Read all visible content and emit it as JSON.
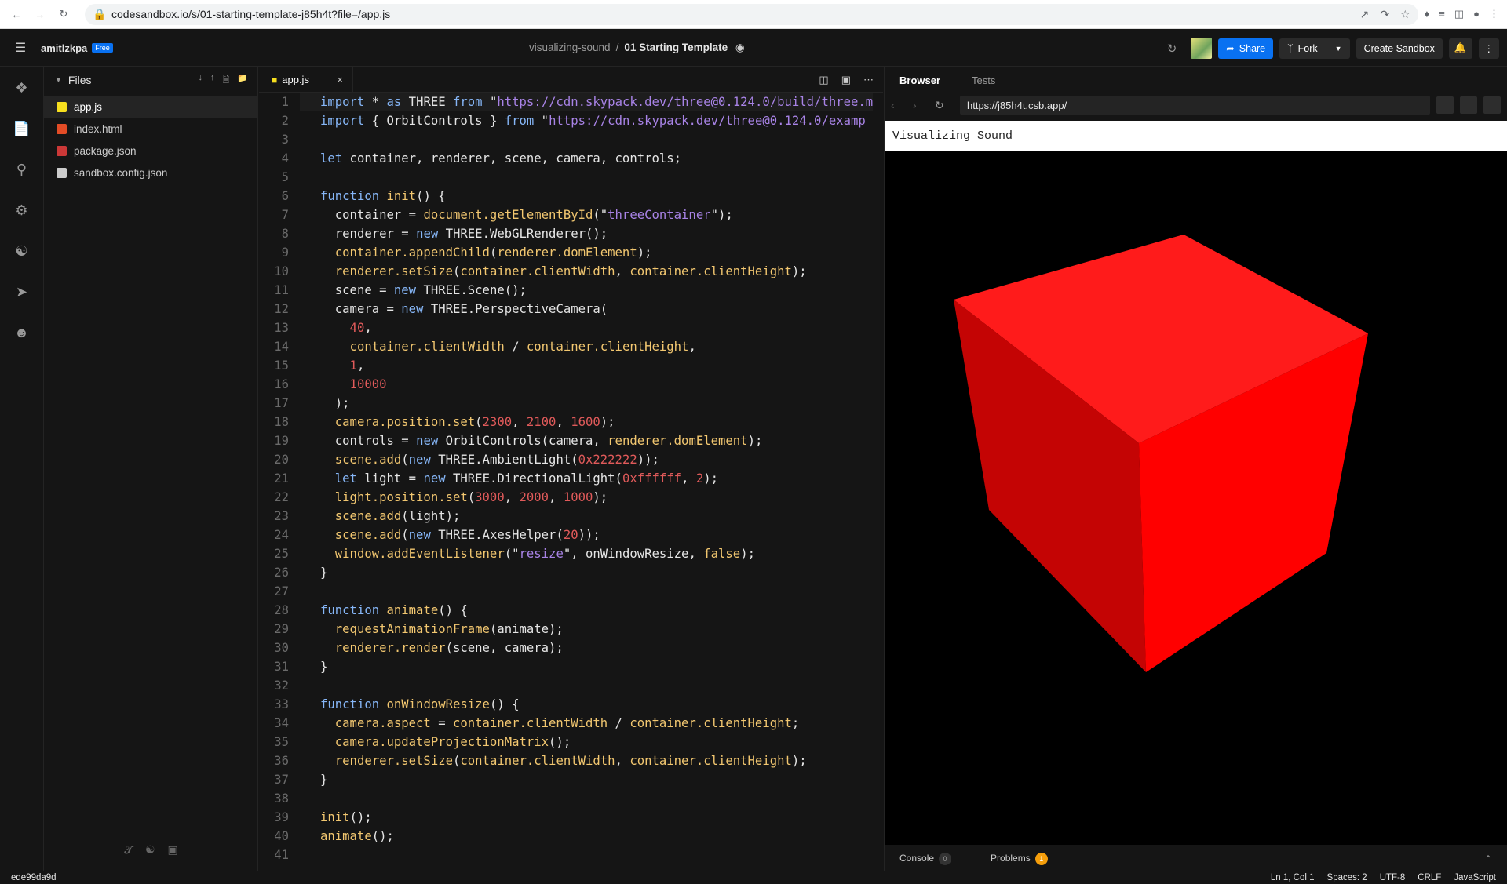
{
  "browser": {
    "url": "codesandbox.io/s/01-starting-template-j85h4t?file=/app.js"
  },
  "topbar": {
    "user": "amitlzkpa",
    "plan": "Free",
    "crumb_parent": "visualizing-sound",
    "crumb_sep": "/",
    "title": "01 Starting Template",
    "share": "Share",
    "fork": "Fork",
    "create": "Create Sandbox"
  },
  "files": {
    "header": "Files",
    "items": [
      {
        "name": "app.js",
        "icon": "js-icon",
        "color": "#f7df1e",
        "selected": true
      },
      {
        "name": "index.html",
        "icon": "html-icon",
        "color": "#e34c26"
      },
      {
        "name": "package.json",
        "icon": "npm-icon",
        "color": "#cb3837"
      },
      {
        "name": "sandbox.config.json",
        "icon": "cube-icon",
        "color": "#cccccc"
      }
    ]
  },
  "editor": {
    "tab": "app.js",
    "close": "×"
  },
  "code": [
    [
      [
        "k",
        "import"
      ],
      [
        "p",
        " * "
      ],
      [
        "k",
        "as"
      ],
      [
        "p",
        " THREE "
      ],
      [
        "k",
        "from"
      ],
      [
        "p",
        " \""
      ],
      [
        "u",
        "https://cdn.skypack.dev/three@0.124.0/build/three.m"
      ]
    ],
    [
      [
        "k",
        "import"
      ],
      [
        "p",
        " { OrbitControls } "
      ],
      [
        "k",
        "from"
      ],
      [
        "p",
        " \""
      ],
      [
        "u",
        "https://cdn.skypack.dev/three@0.124.0/examp"
      ]
    ],
    [],
    [
      [
        "k",
        "let"
      ],
      [
        "p",
        " container, renderer, scene, camera, controls;"
      ]
    ],
    [],
    [
      [
        "k",
        "function"
      ],
      [
        "p",
        " "
      ],
      [
        "f",
        "init"
      ],
      [
        "p",
        "() {"
      ]
    ],
    [
      [
        "p",
        "  container = "
      ],
      [
        "f",
        "document.getElementById"
      ],
      [
        "p",
        "(\""
      ],
      [
        "s",
        "threeContainer"
      ],
      [
        "p",
        "\");"
      ]
    ],
    [
      [
        "p",
        "  renderer = "
      ],
      [
        "k",
        "new"
      ],
      [
        "p",
        " THREE.WebGLRenderer();"
      ]
    ],
    [
      [
        "f",
        "  container.appendChild"
      ],
      [
        "p",
        "("
      ],
      [
        "f",
        "renderer.domElement"
      ],
      [
        "p",
        ");"
      ]
    ],
    [
      [
        "f",
        "  renderer.setSize"
      ],
      [
        "p",
        "("
      ],
      [
        "f",
        "container.clientWidth"
      ],
      [
        "p",
        ", "
      ],
      [
        "f",
        "container.clientHeight"
      ],
      [
        "p",
        ");"
      ]
    ],
    [
      [
        "p",
        "  scene = "
      ],
      [
        "k",
        "new"
      ],
      [
        "p",
        " THREE.Scene();"
      ]
    ],
    [
      [
        "p",
        "  camera = "
      ],
      [
        "k",
        "new"
      ],
      [
        "p",
        " THREE.PerspectiveCamera("
      ]
    ],
    [
      [
        "num",
        "    40"
      ],
      [
        "p",
        ","
      ]
    ],
    [
      [
        "f",
        "    container.clientWidth"
      ],
      [
        "p",
        " / "
      ],
      [
        "f",
        "container.clientHeight"
      ],
      [
        "p",
        ","
      ]
    ],
    [
      [
        "num",
        "    1"
      ],
      [
        "p",
        ","
      ]
    ],
    [
      [
        "num",
        "    10000"
      ]
    ],
    [
      [
        "p",
        "  );"
      ]
    ],
    [
      [
        "f",
        "  camera.position.set"
      ],
      [
        "p",
        "("
      ],
      [
        "num",
        "2300"
      ],
      [
        "p",
        ", "
      ],
      [
        "num",
        "2100"
      ],
      [
        "p",
        ", "
      ],
      [
        "num",
        "1600"
      ],
      [
        "p",
        ");"
      ]
    ],
    [
      [
        "p",
        "  controls = "
      ],
      [
        "k",
        "new"
      ],
      [
        "p",
        " OrbitControls(camera, "
      ],
      [
        "f",
        "renderer.domElement"
      ],
      [
        "p",
        ");"
      ]
    ],
    [
      [
        "f",
        "  scene.add"
      ],
      [
        "p",
        "("
      ],
      [
        "k",
        "new"
      ],
      [
        "p",
        " THREE.AmbientLight("
      ],
      [
        "num",
        "0x222222"
      ],
      [
        "p",
        "));"
      ]
    ],
    [
      [
        "k",
        "  let"
      ],
      [
        "p",
        " light = "
      ],
      [
        "k",
        "new"
      ],
      [
        "p",
        " THREE.DirectionalLight("
      ],
      [
        "num",
        "0xffffff"
      ],
      [
        "p",
        ", "
      ],
      [
        "num",
        "2"
      ],
      [
        "p",
        ");"
      ]
    ],
    [
      [
        "f",
        "  light.position.set"
      ],
      [
        "p",
        "("
      ],
      [
        "num",
        "3000"
      ],
      [
        "p",
        ", "
      ],
      [
        "num",
        "2000"
      ],
      [
        "p",
        ", "
      ],
      [
        "num",
        "1000"
      ],
      [
        "p",
        ");"
      ]
    ],
    [
      [
        "f",
        "  scene.add"
      ],
      [
        "p",
        "(light);"
      ]
    ],
    [
      [
        "f",
        "  scene.add"
      ],
      [
        "p",
        "("
      ],
      [
        "k",
        "new"
      ],
      [
        "p",
        " THREE.AxesHelper("
      ],
      [
        "num",
        "20"
      ],
      [
        "p",
        "));"
      ]
    ],
    [
      [
        "f",
        "  window.addEventListener"
      ],
      [
        "p",
        "(\""
      ],
      [
        "s",
        "resize"
      ],
      [
        "p",
        "\", onWindowResize, "
      ],
      [
        "f",
        "false"
      ],
      [
        "p",
        ");"
      ]
    ],
    [
      [
        "p",
        "}"
      ]
    ],
    [],
    [
      [
        "k",
        "function"
      ],
      [
        "p",
        " "
      ],
      [
        "f",
        "animate"
      ],
      [
        "p",
        "() {"
      ]
    ],
    [
      [
        "f",
        "  requestAnimationFrame"
      ],
      [
        "p",
        "(animate);"
      ]
    ],
    [
      [
        "f",
        "  renderer.render"
      ],
      [
        "p",
        "(scene, camera);"
      ]
    ],
    [
      [
        "p",
        "}"
      ]
    ],
    [],
    [
      [
        "k",
        "function"
      ],
      [
        "p",
        " "
      ],
      [
        "f",
        "onWindowResize"
      ],
      [
        "p",
        "() {"
      ]
    ],
    [
      [
        "f",
        "  camera.aspect"
      ],
      [
        "p",
        " = "
      ],
      [
        "f",
        "container.clientWidth"
      ],
      [
        "p",
        " / "
      ],
      [
        "f",
        "container.clientHeight"
      ],
      [
        "p",
        ";"
      ]
    ],
    [
      [
        "f",
        "  camera.updateProjectionMatrix"
      ],
      [
        "p",
        "();"
      ]
    ],
    [
      [
        "f",
        "  renderer.setSize"
      ],
      [
        "p",
        "("
      ],
      [
        "f",
        "container.clientWidth"
      ],
      [
        "p",
        ", "
      ],
      [
        "f",
        "container.clientHeight"
      ],
      [
        "p",
        ");"
      ]
    ],
    [
      [
        "p",
        "}"
      ]
    ],
    [],
    [
      [
        "f",
        "init"
      ],
      [
        "p",
        "();"
      ]
    ],
    [
      [
        "f",
        "animate"
      ],
      [
        "p",
        "();"
      ]
    ],
    []
  ],
  "preview": {
    "tab_browser": "Browser",
    "tab_tests": "Tests",
    "address": "https://j85h4t.csb.app/",
    "page_heading": "Visualizing Sound",
    "console": "Console",
    "console_count": "0",
    "problems": "Problems",
    "problems_count": "1"
  },
  "status": {
    "hash": "ede99da9d",
    "pos": "Ln 1, Col 1",
    "spaces": "Spaces: 2",
    "enc": "UTF-8",
    "eol": "CRLF",
    "lang": "JavaScript"
  }
}
